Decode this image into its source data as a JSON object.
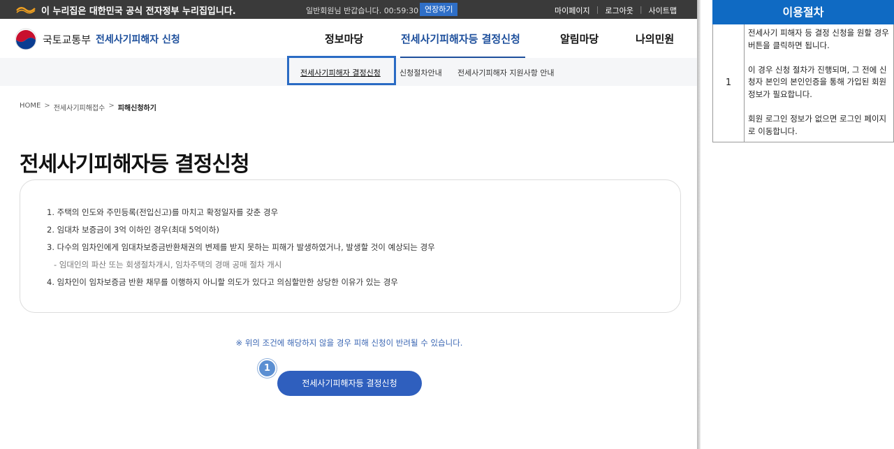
{
  "gov_bar": {
    "notice": "이 누리집은 대한민국 공식 전자정부 누리집입니다.",
    "session": "일반회원님 반갑습니다. 00:59:30",
    "extend_label": "연장하기",
    "links": [
      "마이페이지",
      "로그아웃",
      "사이트맵"
    ]
  },
  "header": {
    "ministry": "국토교통부",
    "service": "전세사기피해자 신청",
    "nav": [
      "정보마당",
      "전세사기피해자등 결정신청",
      "알림마당",
      "나의민원"
    ],
    "active_nav_index": 1
  },
  "subnav": {
    "items": [
      "전세사기피해자 결정신청",
      "신청절차안내",
      "전세사기피해자 지원사항 안내"
    ],
    "active_index": 0
  },
  "breadcrumb": [
    "HOME",
    "전세사기피해접수",
    "피해신청하기"
  ],
  "page_title": "전세사기피해자등 결정신청",
  "conditions": [
    "1. 주택의 인도와 주민등록(전입신고)를 마치고 확정일자를 갖춘 경우",
    "2. 임대차 보증금이 3억 이하인 경우(최대 5억이하)",
    "3. 다수의 임차인에게 임대차보증금반환채권의 변제를 받지 못하는 피해가 발생하였거나, 발생할 것이 예상되는 경우",
    "-  임대인의 파산 또는 회생절차개시, 임차주택의 경매 공매 절차 개시",
    "4. 임차인이 임차보증금 반환 채무를 이행하지 아니할 의도가 있다고 의심할만한 상당한 이유가 있는 경우"
  ],
  "notice": "※ 위의 조건에 해당하지 않을 경우 피해 신청이 반려될 수 있습니다.",
  "step_badge": "1",
  "apply_button": "전세사기피해자등 결정신청",
  "guide": {
    "title": "이용절차",
    "row_number": "1",
    "text": "전세사기 피해자 등 결정 신청을 원할 경우 버튼을 클릭하면 됩니다.\n\n이 경우 신청 절차가 진행되며, 그 전에 신청자 본인의 본인인증을 통해 가입된 회원 정보가 필요합니다.\n\n회원 로그인 정보가 없으면 로그인 페이지로 이동합니다."
  },
  "colors": {
    "gov_bar": "#3a3a3a",
    "brand_blue": "#1d4f9c",
    "button_blue": "#2f5fbe",
    "guide_header": "#0f6ac3"
  }
}
